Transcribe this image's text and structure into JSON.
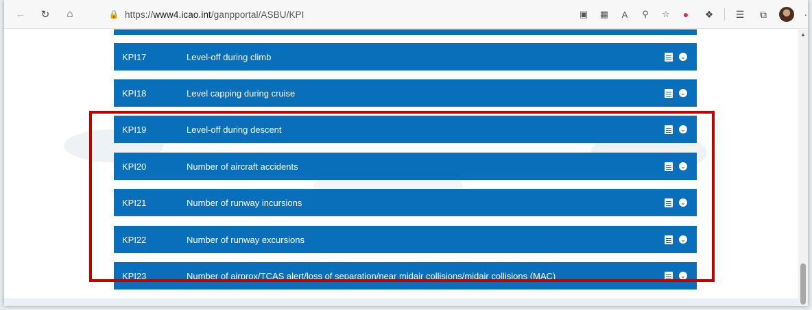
{
  "browser": {
    "url_prefix": "https://",
    "url_host": "www4.icao.int",
    "url_path": "/ganpportal/ASBU/KPI"
  },
  "toolbar_icons": {
    "back": "back-arrow-icon",
    "refresh": "refresh-icon",
    "home": "home-icon",
    "lock": "lock-icon"
  },
  "kpi_rows": [
    {
      "code": "KPI17",
      "title": "Level-off during climb"
    },
    {
      "code": "KPI18",
      "title": "Level capping during cruise"
    },
    {
      "code": "KPI19",
      "title": "Level-off during descent"
    },
    {
      "code": "KPI20",
      "title": "Number of aircraft accidents"
    },
    {
      "code": "KPI21",
      "title": "Number of runway incursions"
    },
    {
      "code": "KPI22",
      "title": "Number of runway excursions"
    },
    {
      "code": "KPI23",
      "title": "Number of airprox/TCAS alert/loss of separation/near midair collisions/midair collisions (MAC)"
    }
  ],
  "colors": {
    "row_bg": "#0a6fba",
    "highlight": "#c00000"
  }
}
